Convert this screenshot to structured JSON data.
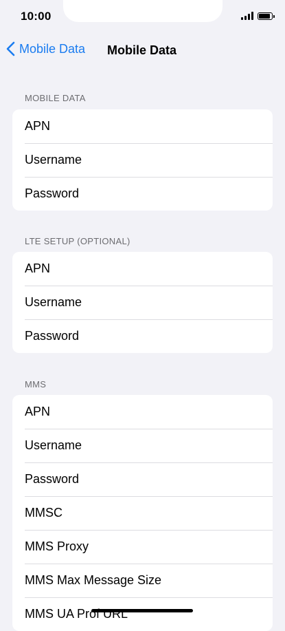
{
  "status": {
    "time": "10:00"
  },
  "nav": {
    "back_label": "Mobile Data",
    "title": "Mobile Data"
  },
  "sections": [
    {
      "header": "MOBILE DATA",
      "rows": [
        "APN",
        "Username",
        "Password"
      ]
    },
    {
      "header": "LTE SETUP (OPTIONAL)",
      "rows": [
        "APN",
        "Username",
        "Password"
      ]
    },
    {
      "header": "MMS",
      "rows": [
        "APN",
        "Username",
        "Password",
        "MMSC",
        "MMS Proxy",
        "MMS Max Message Size",
        "MMS UA Prof URL"
      ]
    }
  ],
  "colors": {
    "accent": "#1a7cf0",
    "background": "#f2f2f7",
    "header_text": "#6c6c70"
  }
}
